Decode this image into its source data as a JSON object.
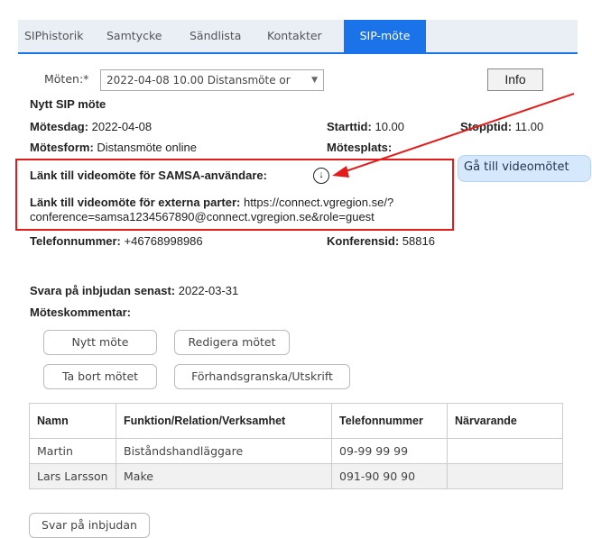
{
  "tabs": [
    {
      "label": "SIPhistorik",
      "active": false
    },
    {
      "label": "Samtycke",
      "active": false
    },
    {
      "label": "Sändlista",
      "active": false
    },
    {
      "label": "Kontakter",
      "active": false
    },
    {
      "label": "SIP-möte",
      "active": true
    }
  ],
  "meeting_select": {
    "label": "Möten:*",
    "value": "2022-04-08 10.00 Distansmöte or"
  },
  "info_button": "Info",
  "heading": "Nytt SIP möte",
  "fields": {
    "motesdag": {
      "label": "Mötesdag:",
      "value": "2022-04-08"
    },
    "starttid": {
      "label": "Starttid:",
      "value": "10.00"
    },
    "stopptid": {
      "label": "Stopptid:",
      "value": "11.00"
    },
    "motesform": {
      "label": "Mötesform:",
      "value": "Distansmöte online"
    },
    "motesplats": {
      "label": "Mötesplats:",
      "value": ""
    },
    "samsa_link": {
      "label": "Länk till videomöte för SAMSA-användare:"
    },
    "extern_link": {
      "label": "Länk till videomöte för externa parter:",
      "value_line1": "https://connect.vgregion.se/?",
      "value_line2": "conference=samsa1234567890@connect.vgregion.se&role=guest"
    },
    "telefon": {
      "label": "Telefonnummer:",
      "value": "+46768998986"
    },
    "konferens": {
      "label": "Konferensid:",
      "value": "58816"
    },
    "svara_senast": {
      "label": "Svara på inbjudan senast:",
      "value": "2022-03-31"
    },
    "kommentar": {
      "label": "Möteskommentar:"
    }
  },
  "video_button": "Gå till videomötet",
  "buttons": {
    "nytt": "Nytt möte",
    "redigera": "Redigera mötet",
    "ta_bort": "Ta bort mötet",
    "forhands": "Förhandsgranska/Utskrift",
    "svar": "Svar på inbjudan"
  },
  "table": {
    "headers": [
      "Namn",
      "Funktion/Relation/Verksamhet",
      "Telefonnummer",
      "Närvarande"
    ],
    "rows": [
      [
        "Martin",
        "Biståndshandläggare",
        "09-99 99 99",
        ""
      ],
      [
        "Lars Larsson",
        "Make",
        "091-90 90 90",
        ""
      ]
    ]
  },
  "colors": {
    "accent": "#1a73e8",
    "highlight": "#e21b1b",
    "video_button_bg": "#d6e8fb"
  },
  "icons": {
    "download": "down-arrow-circle-icon",
    "annotation_arrow": "red-arrow-icon"
  }
}
